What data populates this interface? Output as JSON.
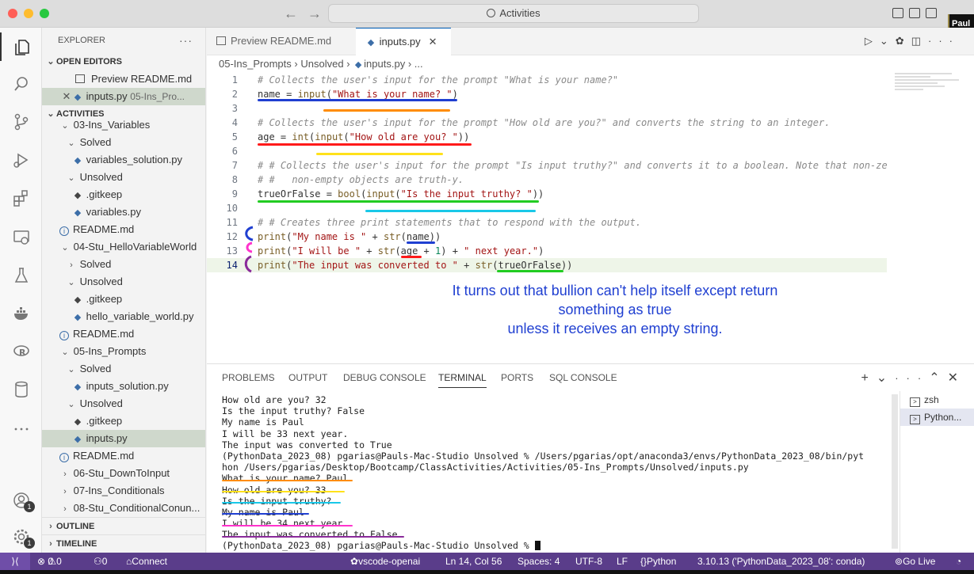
{
  "title_bar": {
    "search_text": "Activities",
    "webcam_name": "Paul J"
  },
  "activity_bar": {
    "badges": [
      "1",
      "1"
    ]
  },
  "sidebar": {
    "explorer_title": "EXPLORER",
    "more": "···",
    "open_editors_label": "OPEN EDITORS",
    "open_editors": [
      {
        "label": "Preview README.md",
        "desc": ""
      },
      {
        "label": "inputs.py",
        "desc": "05-Ins_Pro..."
      }
    ],
    "activities_label": "ACTIVITIES",
    "tree": [
      {
        "label": "03-Ins_Variables",
        "kind": "folder-open",
        "indent": 0
      },
      {
        "label": "Solved",
        "kind": "folder-open",
        "indent": 1
      },
      {
        "label": "variables_solution.py",
        "kind": "py",
        "indent": 2
      },
      {
        "label": "Unsolved",
        "kind": "folder-open",
        "indent": 1
      },
      {
        "label": ".gitkeep",
        "kind": "git",
        "indent": 2
      },
      {
        "label": "variables.py",
        "kind": "py",
        "indent": 2
      },
      {
        "label": "README.md",
        "kind": "info",
        "indent": 1
      },
      {
        "label": "04-Stu_HelloVariableWorld",
        "kind": "folder-open",
        "indent": 0
      },
      {
        "label": "Solved",
        "kind": "folder-closed",
        "indent": 1
      },
      {
        "label": "Unsolved",
        "kind": "folder-open",
        "indent": 1
      },
      {
        "label": ".gitkeep",
        "kind": "git",
        "indent": 2
      },
      {
        "label": "hello_variable_world.py",
        "kind": "py",
        "indent": 2
      },
      {
        "label": "README.md",
        "kind": "info",
        "indent": 1
      },
      {
        "label": "05-Ins_Prompts",
        "kind": "folder-open",
        "indent": 0
      },
      {
        "label": "Solved",
        "kind": "folder-open",
        "indent": 1
      },
      {
        "label": "inputs_solution.py",
        "kind": "py",
        "indent": 2
      },
      {
        "label": "Unsolved",
        "kind": "folder-open",
        "indent": 1
      },
      {
        "label": ".gitkeep",
        "kind": "git",
        "indent": 2
      },
      {
        "label": "inputs.py",
        "kind": "py",
        "indent": 2,
        "selected": true
      },
      {
        "label": "README.md",
        "kind": "info",
        "indent": 1
      },
      {
        "label": "06-Stu_DownToInput",
        "kind": "folder-closed",
        "indent": 0
      },
      {
        "label": "07-Ins_Conditionals",
        "kind": "folder-closed",
        "indent": 0
      },
      {
        "label": "08-Stu_ConditionalConun...",
        "kind": "folder-closed",
        "indent": 0
      }
    ],
    "outline_label": "OUTLINE",
    "timeline_label": "TIMELINE"
  },
  "editor": {
    "tabs": [
      {
        "label": "Preview README.md",
        "active": false
      },
      {
        "label": "inputs.py",
        "active": true
      }
    ],
    "breadcrumb": [
      "05-Ins_Prompts",
      "Unsolved",
      "inputs.py",
      "..."
    ],
    "current_line": 14,
    "lines": [
      "# Collects the user's input for the prompt \"What is your name?\"",
      "name = input(\"What is your name? \")",
      "",
      "# Collects the user's input for the prompt \"How old are you?\" and converts the string to an integer.",
      "age = int(input(\"How old are you? \"))",
      "",
      "# # Collects the user's input for the prompt \"Is input truthy?\" and converts it to a boolean. Note that non-ze",
      "# #   non-empty objects are truth-y.",
      "trueOrFalse = bool(input(\"Is the input truthy? \"))",
      "",
      "# # Creates three print statements that to respond with the output.",
      "print(\"My name is \" + str(name))",
      "print(\"I will be \" + str(age + 1) + \" next year.\")",
      "print(\"The input was converted to \" + str(trueOrFalse))"
    ],
    "caption_line1": "It turns out that bullion can't help itself except return something as true",
    "caption_line2": "unless it receives an empty string."
  },
  "panel": {
    "tabs": [
      "PROBLEMS",
      "OUTPUT",
      "DEBUG CONSOLE",
      "TERMINAL",
      "PORTS",
      "SQL CONSOLE"
    ],
    "active_tab": "TERMINAL",
    "terminal_lines": [
      "How old are you? 32",
      "Is the input truthy? False",
      "My name is Paul",
      "I will be 33 next year.",
      "The input was converted to True",
      "(PythonData_2023_08) pgarias@Pauls-Mac-Studio Unsolved % /Users/pgarias/opt/anaconda3/envs/PythonData_2023_08/bin/pyt",
      "hon /Users/pgarias/Desktop/Bootcamp/ClassActivities/Activities/05-Ins_Prompts/Unsolved/inputs.py",
      "What is your name? Paul",
      "How old are you? 33",
      "Is the input truthy?",
      "My name is Paul",
      "I will be 34 next year.",
      "The input was converted to False",
      "(PythonData_2023_08) pgarias@Pauls-Mac-Studio Unsolved % "
    ],
    "terminal_list": [
      "zsh",
      "Python..."
    ]
  },
  "status_bar": {
    "errors": "0",
    "warnings": "0",
    "ports": "0",
    "connect": "Connect",
    "workspace": "vscode-openai",
    "position": "Ln 14, Col 56",
    "spaces": "Spaces: 4",
    "encoding": "UTF-8",
    "eol": "LF",
    "language": "Python",
    "interpreter": "3.10.13 ('PythonData_2023_08': conda)",
    "golive": "Go Live"
  },
  "colors": {
    "status_bg": "#5a3d8a",
    "accent": "#005fb8",
    "annotation_blue": "#1f3fd1",
    "annotation_orange": "#ff8c00",
    "annotation_red": "#ff1a1a",
    "annotation_yellow": "#ffe11a",
    "annotation_green": "#22cc22",
    "annotation_cyan": "#19c8e8",
    "annotation_purple": "#8a2a9a",
    "annotation_pink": "#ff33cc"
  }
}
